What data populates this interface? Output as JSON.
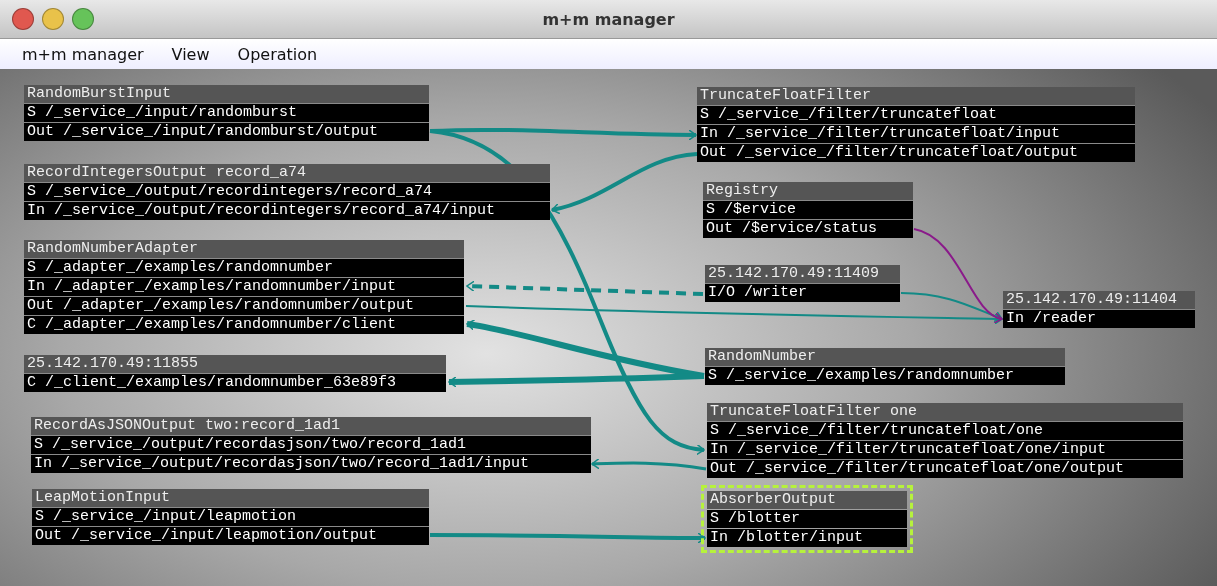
{
  "window": {
    "title": "m+m manager"
  },
  "menu": [
    "m+m manager",
    "View",
    "Operation"
  ],
  "nodes": [
    {
      "title": "RandomBurstInput",
      "selected": false,
      "ports": [
        "S /_service_/input/randomburst",
        "Out /_service_/input/randomburst/output"
      ]
    },
    {
      "title": "RecordIntegersOutput record_a74",
      "selected": false,
      "ports": [
        "S /_service_/output/recordintegers/record_a74",
        "In /_service_/output/recordintegers/record_a74/input"
      ]
    },
    {
      "title": "RandomNumberAdapter",
      "selected": false,
      "ports": [
        "S /_adapter_/examples/randomnumber",
        "In /_adapter_/examples/randomnumber/input",
        "Out /_adapter_/examples/randomnumber/output",
        "C /_adapter_/examples/randomnumber/client"
      ]
    },
    {
      "title": "25.142.170.49:11855",
      "selected": false,
      "ports": [
        "C /_client_/examples/randomnumber_63e89f3"
      ]
    },
    {
      "title": "RecordAsJSONOutput two:record_1ad1",
      "selected": false,
      "ports": [
        "S /_service_/output/recordasjson/two/record_1ad1",
        "In /_service_/output/recordasjson/two/record_1ad1/input"
      ]
    },
    {
      "title": "LeapMotionInput",
      "selected": false,
      "ports": [
        "S /_service_/input/leapmotion",
        "Out /_service_/input/leapmotion/output"
      ]
    },
    {
      "title": "TruncateFloatFilter",
      "selected": false,
      "ports": [
        "S /_service_/filter/truncatefloat",
        "In /_service_/filter/truncatefloat/input",
        "Out /_service_/filter/truncatefloat/output"
      ]
    },
    {
      "title": "Registry",
      "selected": false,
      "ports": [
        "S /$ervice",
        "Out /$ervice/status"
      ]
    },
    {
      "title": "25.142.170.49:11409",
      "selected": false,
      "ports": [
        "I/O /writer"
      ]
    },
    {
      "title": "25.142.170.49:11404",
      "selected": false,
      "ports": [
        "In /reader"
      ]
    },
    {
      "title": "RandomNumber",
      "selected": false,
      "ports": [
        "S /_service_/examples/randomnumber"
      ]
    },
    {
      "title": "TruncateFloatFilter one",
      "selected": false,
      "ports": [
        "S /_service_/filter/truncatefloat/one",
        "In /_service_/filter/truncatefloat/one/input",
        "Out /_service_/filter/truncatefloat/one/output"
      ]
    },
    {
      "title": "AbsorberOutput",
      "selected": true,
      "ports": [
        "S /blotter",
        "In /blotter/input"
      ]
    }
  ]
}
